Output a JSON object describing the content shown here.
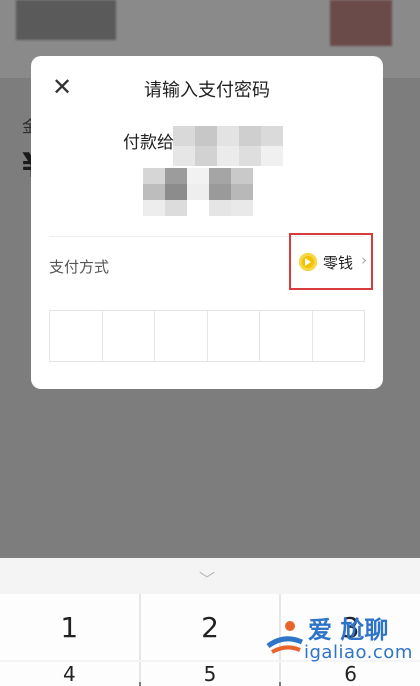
{
  "background": {
    "amount_label": "金",
    "amount_prefix": "¥"
  },
  "dialog": {
    "title": "请输入支付密码",
    "close_icon": "close-icon",
    "payee_label": "付款给",
    "payment_method_label": "支付方式",
    "payment_method_value": "零钱",
    "payment_method_icon": "wallet-change-icon",
    "pin_length": 6
  },
  "keypad": {
    "keys": [
      "1",
      "2",
      "3"
    ],
    "next_row": [
      "4",
      "5",
      "6"
    ],
    "collapse_icon": "chevron-down-icon"
  },
  "watermark": {
    "title": "爱 尬聊",
    "url": "igaliao.com"
  },
  "colors": {
    "highlight_border": "#d93a3a",
    "coin": "#f2c200",
    "watermark": "#2e74c9"
  }
}
